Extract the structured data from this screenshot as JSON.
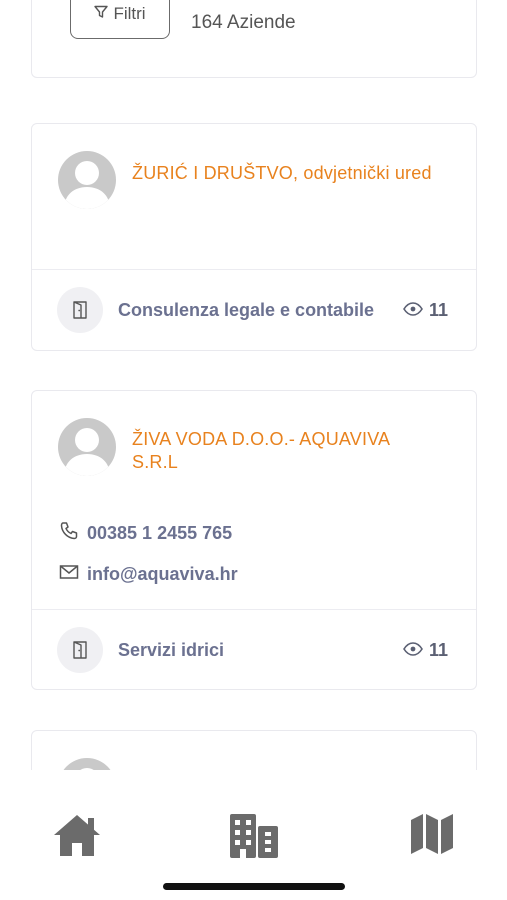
{
  "toolbar": {
    "filter_label": "Filtri",
    "count_label": "164 Aziende"
  },
  "companies": [
    {
      "name": "ŽURIĆ I DRUŠTVO, odvjetnički ured",
      "category": "Consulenza legale e contabile",
      "views": "11",
      "avatar_icon": "user-avatar-placeholder",
      "category_icon": "door-icon"
    },
    {
      "name": "ŽIVA VODA D.O.O.- AQUAVIVA S.R.L",
      "phone": "00385 1 2455 765",
      "email": "info@aquaviva.hr",
      "category": "Servizi idrici",
      "views": "11",
      "avatar_icon": "user-avatar-placeholder",
      "category_icon": "door-icon"
    }
  ],
  "nav": {
    "items": [
      {
        "icon": "home-icon"
      },
      {
        "icon": "buildings-icon"
      },
      {
        "icon": "map-icon"
      }
    ]
  },
  "colors": {
    "accent": "#e8821e",
    "text_muted": "#6b7190",
    "nav_icon": "#6b6b6b"
  }
}
